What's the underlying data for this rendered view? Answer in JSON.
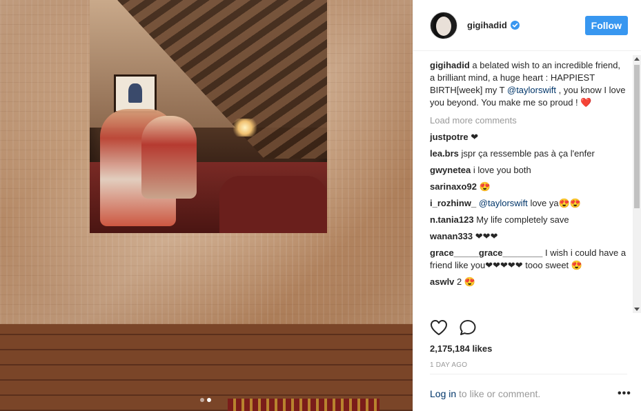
{
  "post": {
    "carousel": {
      "count": 2,
      "active_index": 1
    }
  },
  "header": {
    "username": "gigihadid",
    "verified": true,
    "follow_label": "Follow"
  },
  "caption": {
    "username": "gigihadid",
    "text_before": "a belated wish to an incredible friend, a brilliant mind, a huge heart : HAPPIEST BIRTH[week] my T",
    "mention": "@taylorswift",
    "text_after": ", you know I love you beyond. You make me so proud ! ❤️"
  },
  "load_more": "Load more comments",
  "comments": [
    {
      "username": "justpotre",
      "text": "❤"
    },
    {
      "username": "lea.brs",
      "text": "jspr ça ressemble pas à ça l'enfer"
    },
    {
      "username": "gwynetea",
      "text": "i love you both"
    },
    {
      "username": "sarinaxo92",
      "text": "😍"
    },
    {
      "username": "i_rozhinw_",
      "mention": "@taylorswift",
      "text": "love ya😍😍"
    },
    {
      "username": "n.tania123",
      "text": "My life completely save"
    },
    {
      "username": "wanan333",
      "text": "❤❤❤"
    },
    {
      "username": "grace_____grace________",
      "text": "I wish i could have a friend like you❤❤❤❤❤ tooo sweet 😍"
    },
    {
      "username": "aswlv",
      "text": "2 😍"
    }
  ],
  "likes": "2,175,184 likes",
  "timestamp": "1 DAY AGO",
  "login": {
    "link": "Log in",
    "text": " to like or comment."
  },
  "more_label": "•••",
  "icons": {
    "like": "heart-icon",
    "comment": "comment-icon",
    "verified": "verified-badge-icon",
    "more": "more-options-icon"
  },
  "colors": {
    "follow": "#3897f0",
    "link": "#003569",
    "muted": "#999999",
    "verified": "#3897f0"
  }
}
